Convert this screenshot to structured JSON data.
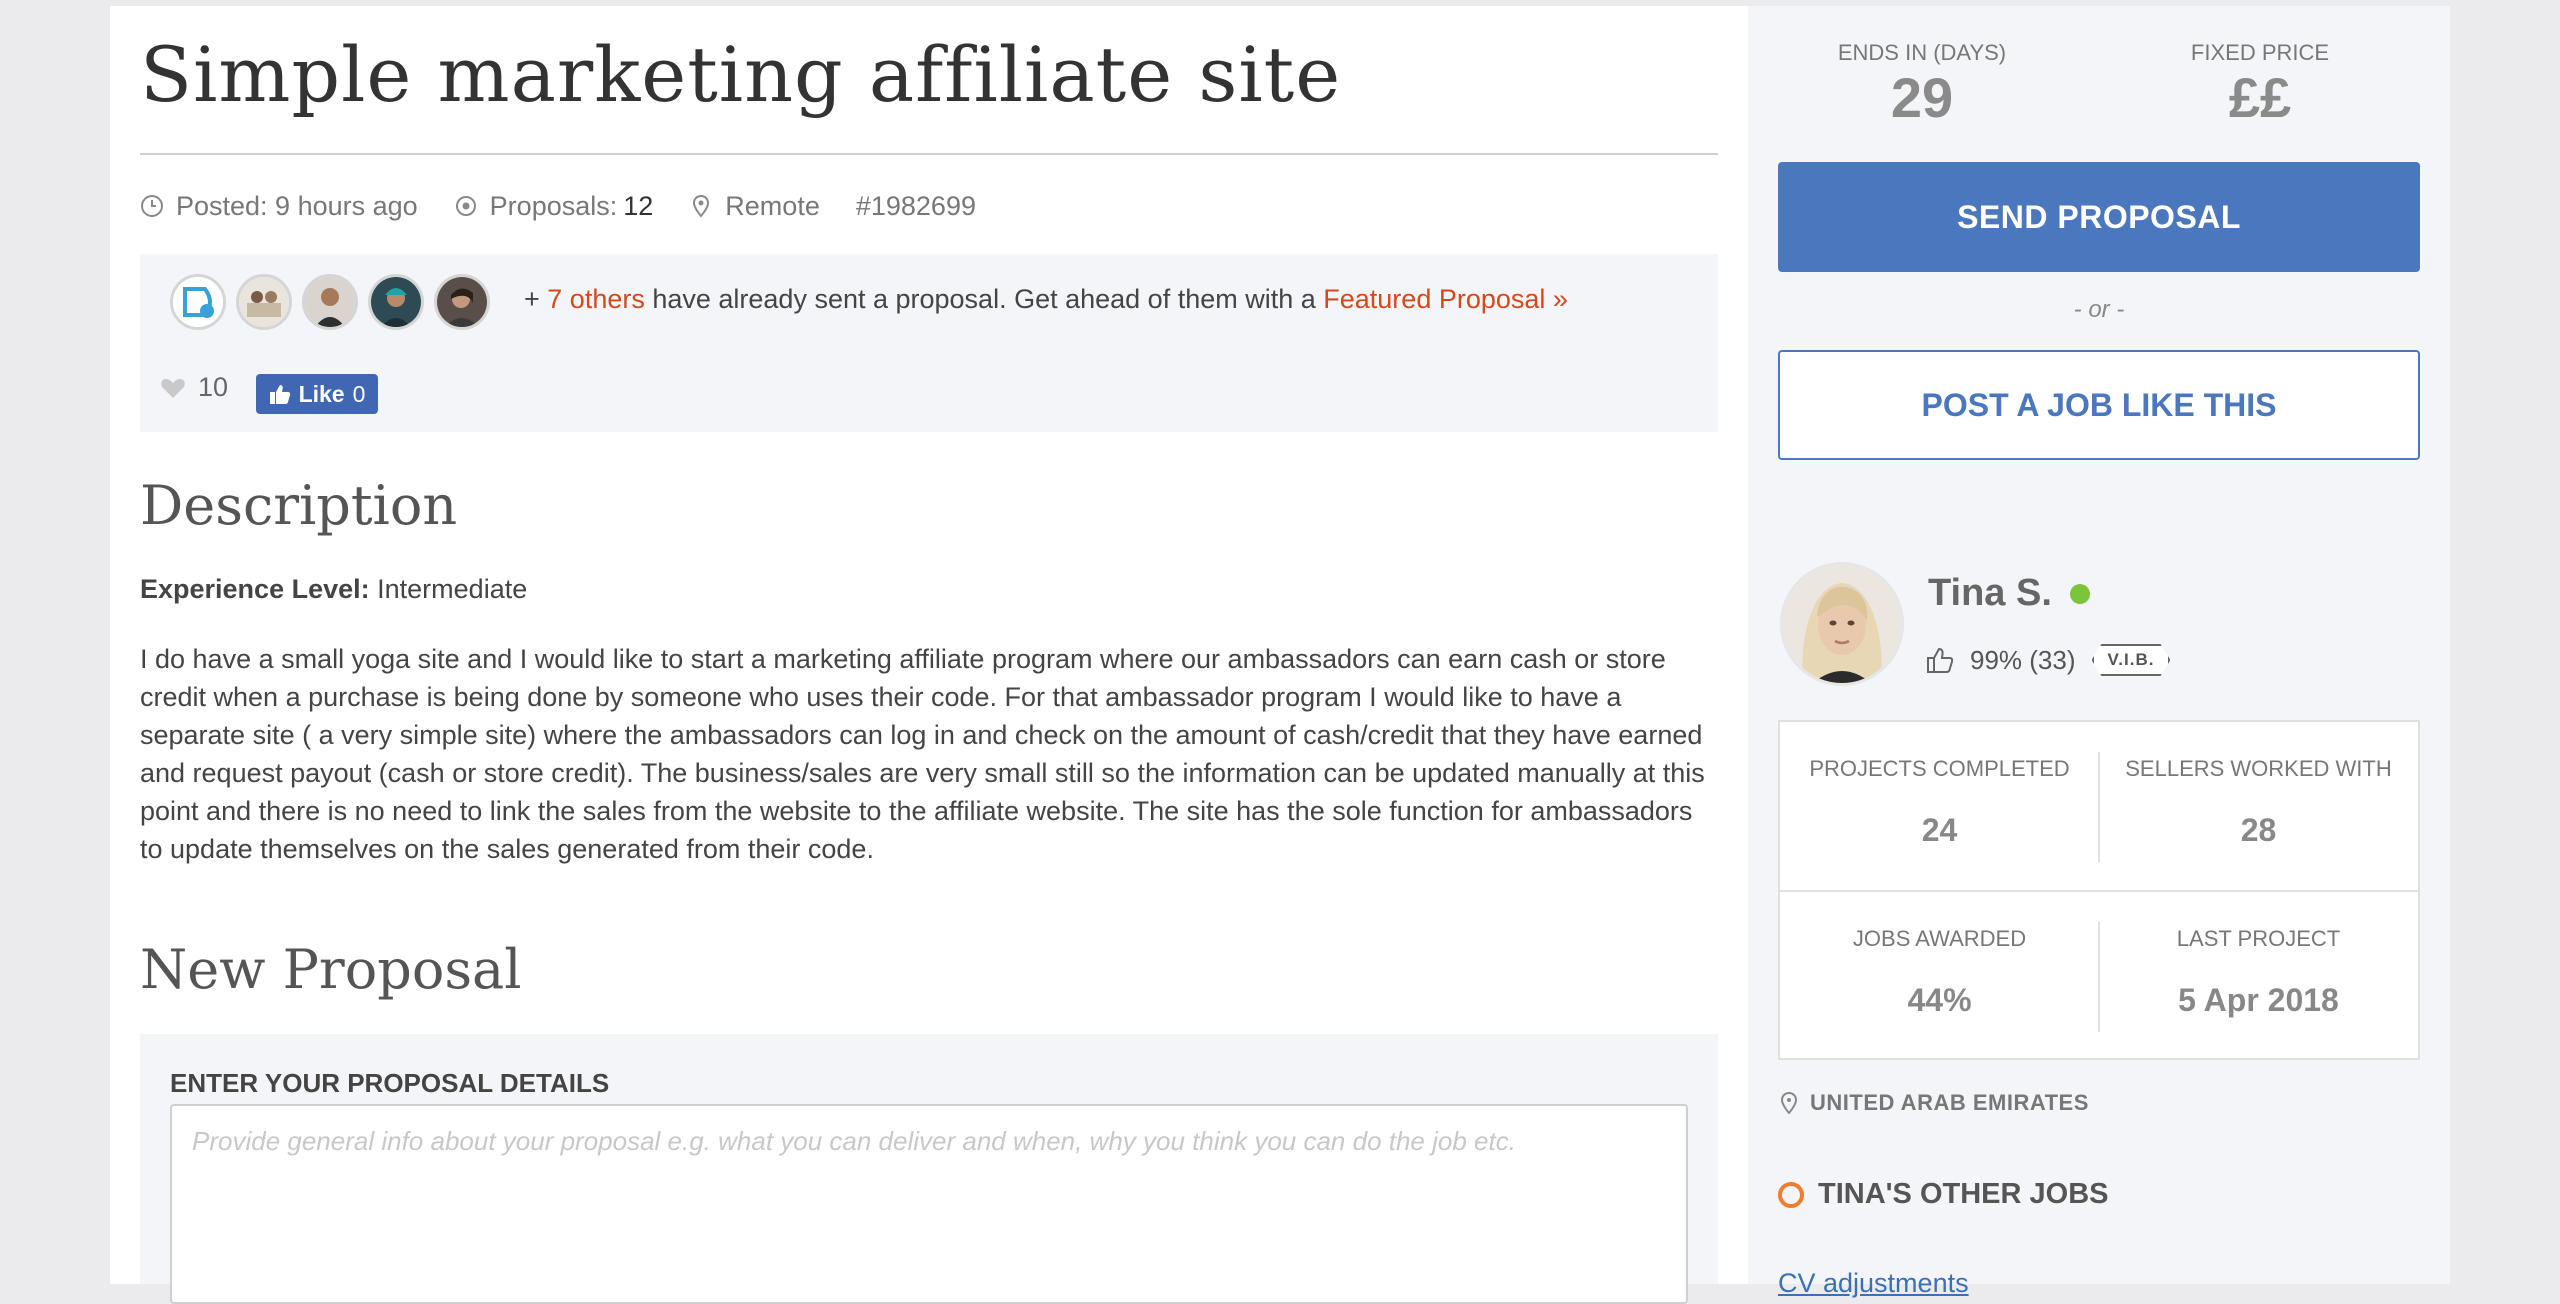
{
  "job": {
    "title": "Simple marketing affiliate site",
    "posted": "Posted: 9 hours ago",
    "proposals_label": "Proposals:",
    "proposals_count": "12",
    "location": "Remote",
    "job_id": "#1982699"
  },
  "promo": {
    "prefix": "+ ",
    "others_link": "7 others",
    "middle": " have already sent a proposal. Get ahead of them with a ",
    "featured_link": "Featured Proposal »",
    "likes_count": "10",
    "fb_like_label": "Like",
    "fb_like_count": "0",
    "avatar_icons": [
      "proposer-avatar-1",
      "proposer-avatar-2",
      "proposer-avatar-3",
      "proposer-avatar-4",
      "proposer-avatar-5"
    ]
  },
  "description": {
    "heading": "Description",
    "experience_label": "Experience Level:",
    "experience_value": "Intermediate",
    "body": "I do have a small yoga site and I would like to start a marketing affiliate program where our ambassadors can earn cash or store credit when a purchase is being done by someone who uses their code. For that ambassador program I would like to have a separate site ( a very simple site) where the ambassadors can log in and check on the amount of cash/credit that they have earned and request payout (cash or store credit). The business/sales are very small still so the information can be updated manually at this point and there is no need to link the sales from the website to the affiliate website. The site has the sole function for ambassadors to update themselves on the sales generated from their code."
  },
  "new_proposal": {
    "heading": "New Proposal",
    "label": "ENTER YOUR PROPOSAL DETAILS",
    "placeholder": "Provide general info about your proposal e.g. what you can deliver and when, why you think you can do the job etc."
  },
  "sidebar": {
    "ends_label": "ENDS IN (DAYS)",
    "ends_value": "29",
    "price_label": "FIXED PRICE",
    "price_value": "££",
    "send_proposal": "SEND PROPOSAL",
    "or": "- or -",
    "post_job": "POST A JOB LIKE THIS"
  },
  "client": {
    "name": "Tina S.",
    "online": true,
    "rating": "99% (33)",
    "badge": "V.I.B.",
    "stats": [
      {
        "label": "PROJECTS COMPLETED",
        "value": "24"
      },
      {
        "label": "SELLERS WORKED WITH",
        "value": "28"
      },
      {
        "label": "JOBS AWARDED",
        "value": "44%"
      },
      {
        "label": "LAST PROJECT",
        "value": "5 Apr 2018"
      }
    ],
    "location": "UNITED ARAB EMIRATES",
    "other_jobs_heading": "TINA'S OTHER JOBS",
    "other_jobs": [
      "CV adjustments"
    ]
  },
  "colors": {
    "accent_blue": "#4b77be",
    "link_orange": "#d4491b",
    "online_green": "#7cc53b",
    "ring_orange": "#ef7d2e",
    "facebook_blue": "#4267b2"
  }
}
